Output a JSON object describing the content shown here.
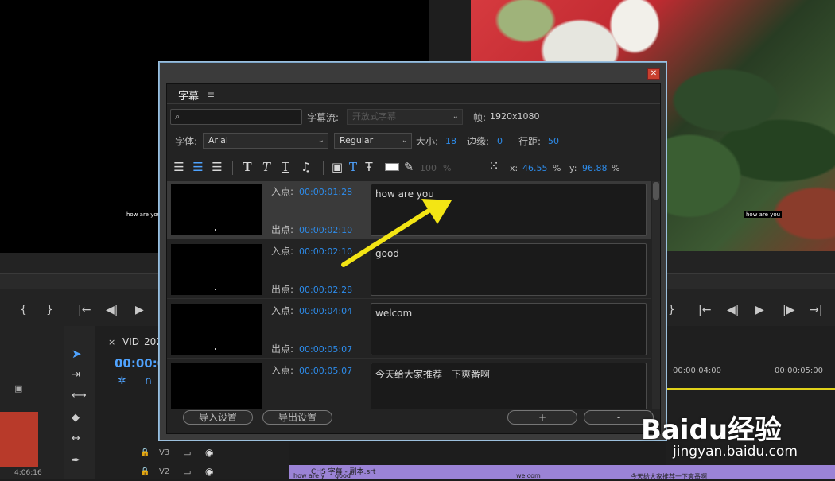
{
  "background": {
    "source_overlay_text": "how are you",
    "program_overlay_text": "how are you",
    "sequence_tab": "VID_2020",
    "sequence_timecode": "00:00:0",
    "timeline_times": [
      "00:00:04:00",
      "00:00:05:00"
    ],
    "clip_duration": "4:06:16",
    "track_v3": "V3",
    "track_v2": "V2",
    "caption_track_label": "CHS 字幕 - 副本.srt",
    "caption_clips": [
      "how are y",
      "good",
      "welcom",
      "今天给大家推荐一下爽番啊"
    ]
  },
  "dialog": {
    "panel_title": "字幕",
    "stream_label": "字幕流:",
    "stream_value": "开放式字幕",
    "frame_label": "帧:",
    "frame_value": "1920x1080",
    "font_label": "字体:",
    "font_value": "Arial",
    "style_value": "Regular",
    "size_label": "大小:",
    "size_value": "18",
    "edge_label": "边缘:",
    "edge_value": "0",
    "spacing_label": "行距:",
    "spacing_value": "50",
    "opacity_value": "100",
    "opacity_unit": "%",
    "x_label": "x:",
    "x_value": "46.55",
    "x_unit": "%",
    "y_label": "y:",
    "y_value": "96.88",
    "y_unit": "%",
    "in_label": "入点:",
    "out_label": "出点:",
    "captions": [
      {
        "in": "00:00:01:28",
        "out": "00:00:02:10",
        "text": "how are you"
      },
      {
        "in": "00:00:02:10",
        "out": "00:00:02:28",
        "text": "good"
      },
      {
        "in": "00:00:04:04",
        "out": "00:00:05:07",
        "text": "welcom"
      },
      {
        "in": "00:00:05:07",
        "out": "",
        "text": "今天给大家推荐一下爽番啊"
      }
    ],
    "import_button": "导入设置",
    "export_button": "导出设置",
    "add_button": "+",
    "remove_button": "-"
  },
  "watermark": {
    "brand": "Baidu经验",
    "url": "jingyan.baidu.com"
  }
}
